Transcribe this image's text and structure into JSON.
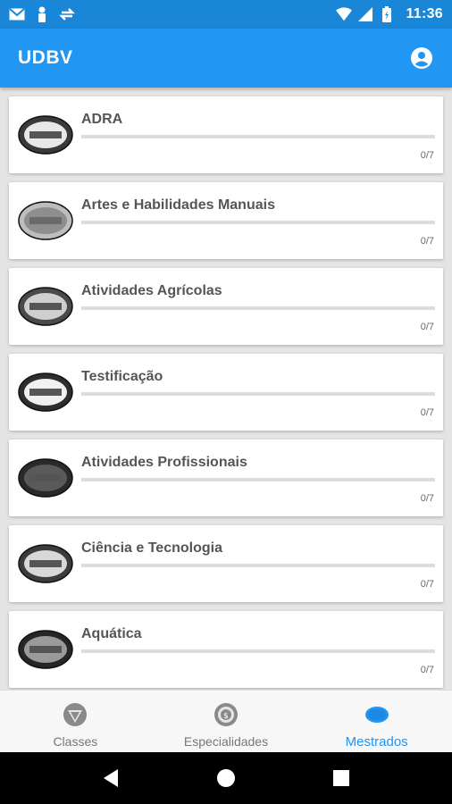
{
  "status_bar": {
    "time": "11:36",
    "left_icons": [
      "gmail-icon",
      "person-icon",
      "sync-icon"
    ],
    "right_icons": [
      "wifi-icon",
      "signal-icon",
      "battery-icon"
    ]
  },
  "app_bar": {
    "title": "UDBV",
    "action_icon": "account-circle-icon"
  },
  "colors": {
    "status_bar": "#1a86d8",
    "app_bar": "#2196f3",
    "accent": "#2196f3",
    "inactive": "#777777"
  },
  "mestrados": [
    {
      "title": "ADRA",
      "progress": "0/7",
      "progress_fraction": 0,
      "badge": "adra-badge-icon"
    },
    {
      "title": "Artes e Habilidades Manuais",
      "progress": "0/7",
      "progress_fraction": 0,
      "badge": "artes-badge-icon"
    },
    {
      "title": "Atividades Agrícolas",
      "progress": "0/7",
      "progress_fraction": 0,
      "badge": "agricolas-badge-icon"
    },
    {
      "title": "Testificação",
      "progress": "0/7",
      "progress_fraction": 0,
      "badge": "testificacao-badge-icon"
    },
    {
      "title": "Atividades Profissionais",
      "progress": "0/7",
      "progress_fraction": 0,
      "badge": "profissionais-badge-icon"
    },
    {
      "title": "Ciência e Tecnologia",
      "progress": "0/7",
      "progress_fraction": 0,
      "badge": "ciencia-badge-icon"
    },
    {
      "title": "Aquática",
      "progress": "0/7",
      "progress_fraction": 0,
      "badge": "aquatica-badge-icon"
    }
  ],
  "bottom_nav": {
    "items": [
      {
        "label": "Classes",
        "icon": "classes-icon",
        "active": false
      },
      {
        "label": "Especialidades",
        "icon": "especialidades-icon",
        "active": false
      },
      {
        "label": "Mestrados",
        "icon": "mestrados-icon",
        "active": true
      }
    ]
  },
  "system_nav": [
    "back-icon",
    "home-icon",
    "recents-icon"
  ]
}
